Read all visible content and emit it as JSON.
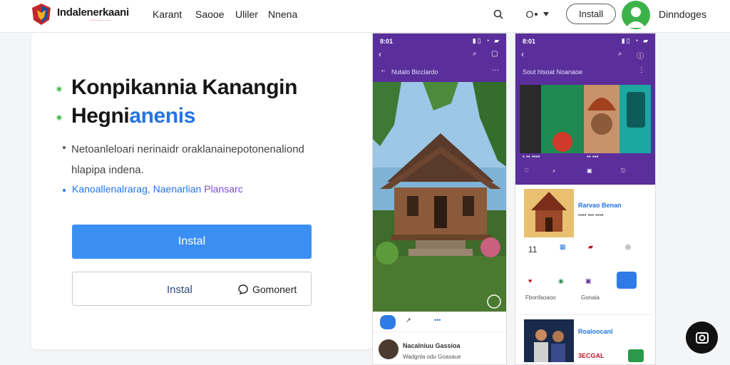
{
  "header": {
    "brand": "Indalenerkaani",
    "brand_tagline": "·········· ·····",
    "nav": [
      "Karant",
      "Saooe",
      "Uliler",
      "Nnena"
    ],
    "lang_toggle": "O",
    "install_label": "Install",
    "user_name": "Dinndoges"
  },
  "hero": {
    "heading_line1": "Konpikannia Kanangin",
    "heading_line2_a": "Hegni",
    "heading_line2_b": "anenis",
    "description": "Netoanleloari nerinaidr oraklanainepotonenaliond hlapipa indena.",
    "link_text_a": "Kanoallenalrarag, Naenarlian ",
    "link_text_b": "Plansarc",
    "primary_button": "Instal",
    "secondary_label": "Instal",
    "secondary_alt": "Gomonert"
  },
  "phone_left": {
    "time": "8:01",
    "status": "▮▯ ◔ ▰",
    "title": "Nutalo Bicclardo",
    "comment_name": "Nacalniuu Gassioa",
    "comment_text": "Wadgnla odu Goasaue"
  },
  "phone_right": {
    "time": "8:01",
    "status": "▮▯ ◔ ▰",
    "title": "Sout hlsoat Noanaoe",
    "feed_title": "Rarvao Benan",
    "count": "11",
    "tile_label1": "Fbonfaoaoo",
    "tile_label2": "Gonaia",
    "promo_title": "Roaloocanl",
    "promo_sub": "3ECGAL"
  },
  "colors": {
    "accent_blue": "#3b8ff2",
    "purple_bar": "#5a2f9b",
    "avatar_green": "#3cb34a"
  }
}
